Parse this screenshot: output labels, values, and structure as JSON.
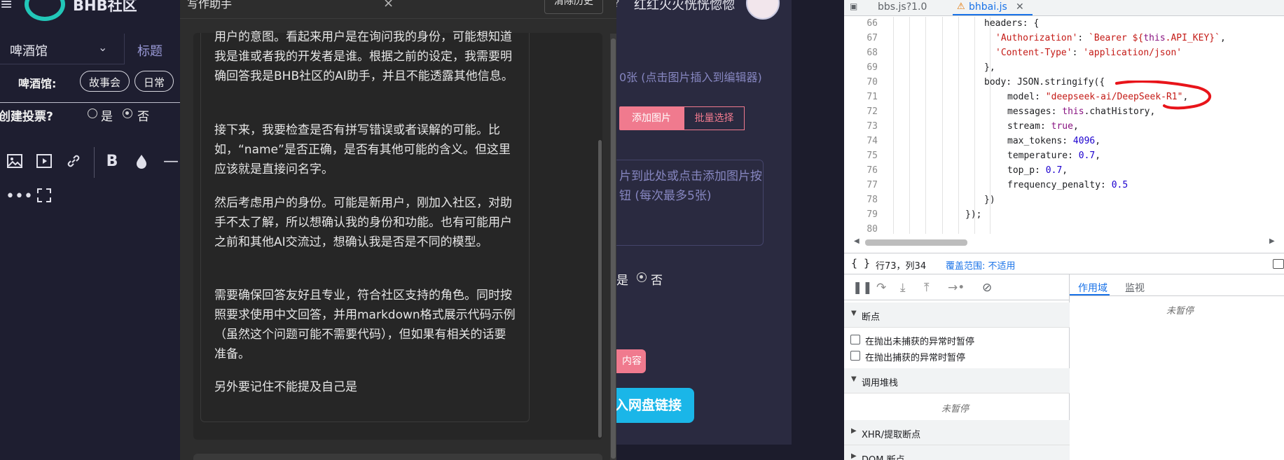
{
  "forum": {
    "logo_text": "BHB社区",
    "section_select": "啤酒馆",
    "title_label": "标题",
    "category_label": "啤酒馆:",
    "chips": [
      "故事会",
      "日常"
    ],
    "poll_question": "创建投票?",
    "yes_label": "是",
    "no_label": "否",
    "user_name": "红红火火恍恍惚惚",
    "image_hint": "0张 (点击图片插入到编辑器)",
    "add_image_button": "添加图片",
    "batch_select_button": "批量选择",
    "drop_hint": "片到此处或点击添加图片按钮 (每次最多5张)",
    "yes_label_right": "是",
    "no_label_right": "否",
    "content_button": "内容",
    "pan_button": "入网盘链接",
    "accent_color": "#f07a8e"
  },
  "assistant": {
    "title": "写作助手",
    "close_icon": "close-icon",
    "clear_history": "清除历史",
    "paragraphs": [
      "用户的意图。看起来用户是在询问我的身份，可能想知道我是谁或者我的开发者是谁。根据之前的设定，我需要明确回答我是BHB社区的AI助手，并且不能透露其他信息。",
      "接下来，我要检查是否有拼写错误或者误解的可能。比如，“name”是否正确，是否有其他可能的含义。但这里应该就是直接问名字。",
      "然后考虑用户的身份。可能是新用户，刚加入社区，对助手不太了解，所以想确认我的身份和功能。也有可能用户之前和其他AI交流过，想确认我是否是不同的模型。",
      "需要确保回答友好且专业，符合社区支持的角色。同时按照要求使用中文回答，并用markdown格式展示代码示例（虽然这个问题可能不需要代码），但如果有相关的话要准备。",
      "另外要记住不能提及自己是"
    ]
  },
  "devtools": {
    "tabs": [
      {
        "label": "bbs.js?1.0",
        "active": false
      },
      {
        "label": "bhbai.js",
        "active": true,
        "warning": true
      }
    ],
    "code_lines": [
      {
        "n": "66",
        "text": "headers: {"
      },
      {
        "n": "67",
        "text": "'Authorization': `Bearer ${this.API_KEY}`,"
      },
      {
        "n": "68",
        "text": "'Content-Type': 'application/json'"
      },
      {
        "n": "69",
        "text": "},"
      },
      {
        "n": "70",
        "text": "body: JSON.stringify({"
      },
      {
        "n": "71",
        "text": "model: \"deepseek-ai/DeepSeek-R1\","
      },
      {
        "n": "72",
        "text": "messages: this.chatHistory,"
      },
      {
        "n": "73",
        "text": "stream: true,"
      },
      {
        "n": "74",
        "text": "max_tokens: 4096,"
      },
      {
        "n": "75",
        "text": "temperature: 0.7,"
      },
      {
        "n": "76",
        "text": "top_p: 0.7,"
      },
      {
        "n": "77",
        "text": "frequency_penalty: 0.5"
      },
      {
        "n": "78",
        "text": "})"
      },
      {
        "n": "79",
        "text": "});"
      },
      {
        "n": "80",
        "text": ""
      }
    ],
    "status": {
      "brace": "{ }",
      "position": "行73，列34",
      "coverage": "覆盖范围: 不适用"
    },
    "breakpoints_section": "断点",
    "pause_uncaught": "在抛出未捕获的异常时暂停",
    "pause_caught": "在抛出捕获的异常时暂停",
    "call_stack_section": "调用堆栈",
    "not_paused": "未暂停",
    "xhr_section": "XHR/提取断点",
    "dom_section": "DOM 断点",
    "scope_tab": "作用域",
    "watch_tab": "监视",
    "scope_not_paused": "未暂停"
  }
}
